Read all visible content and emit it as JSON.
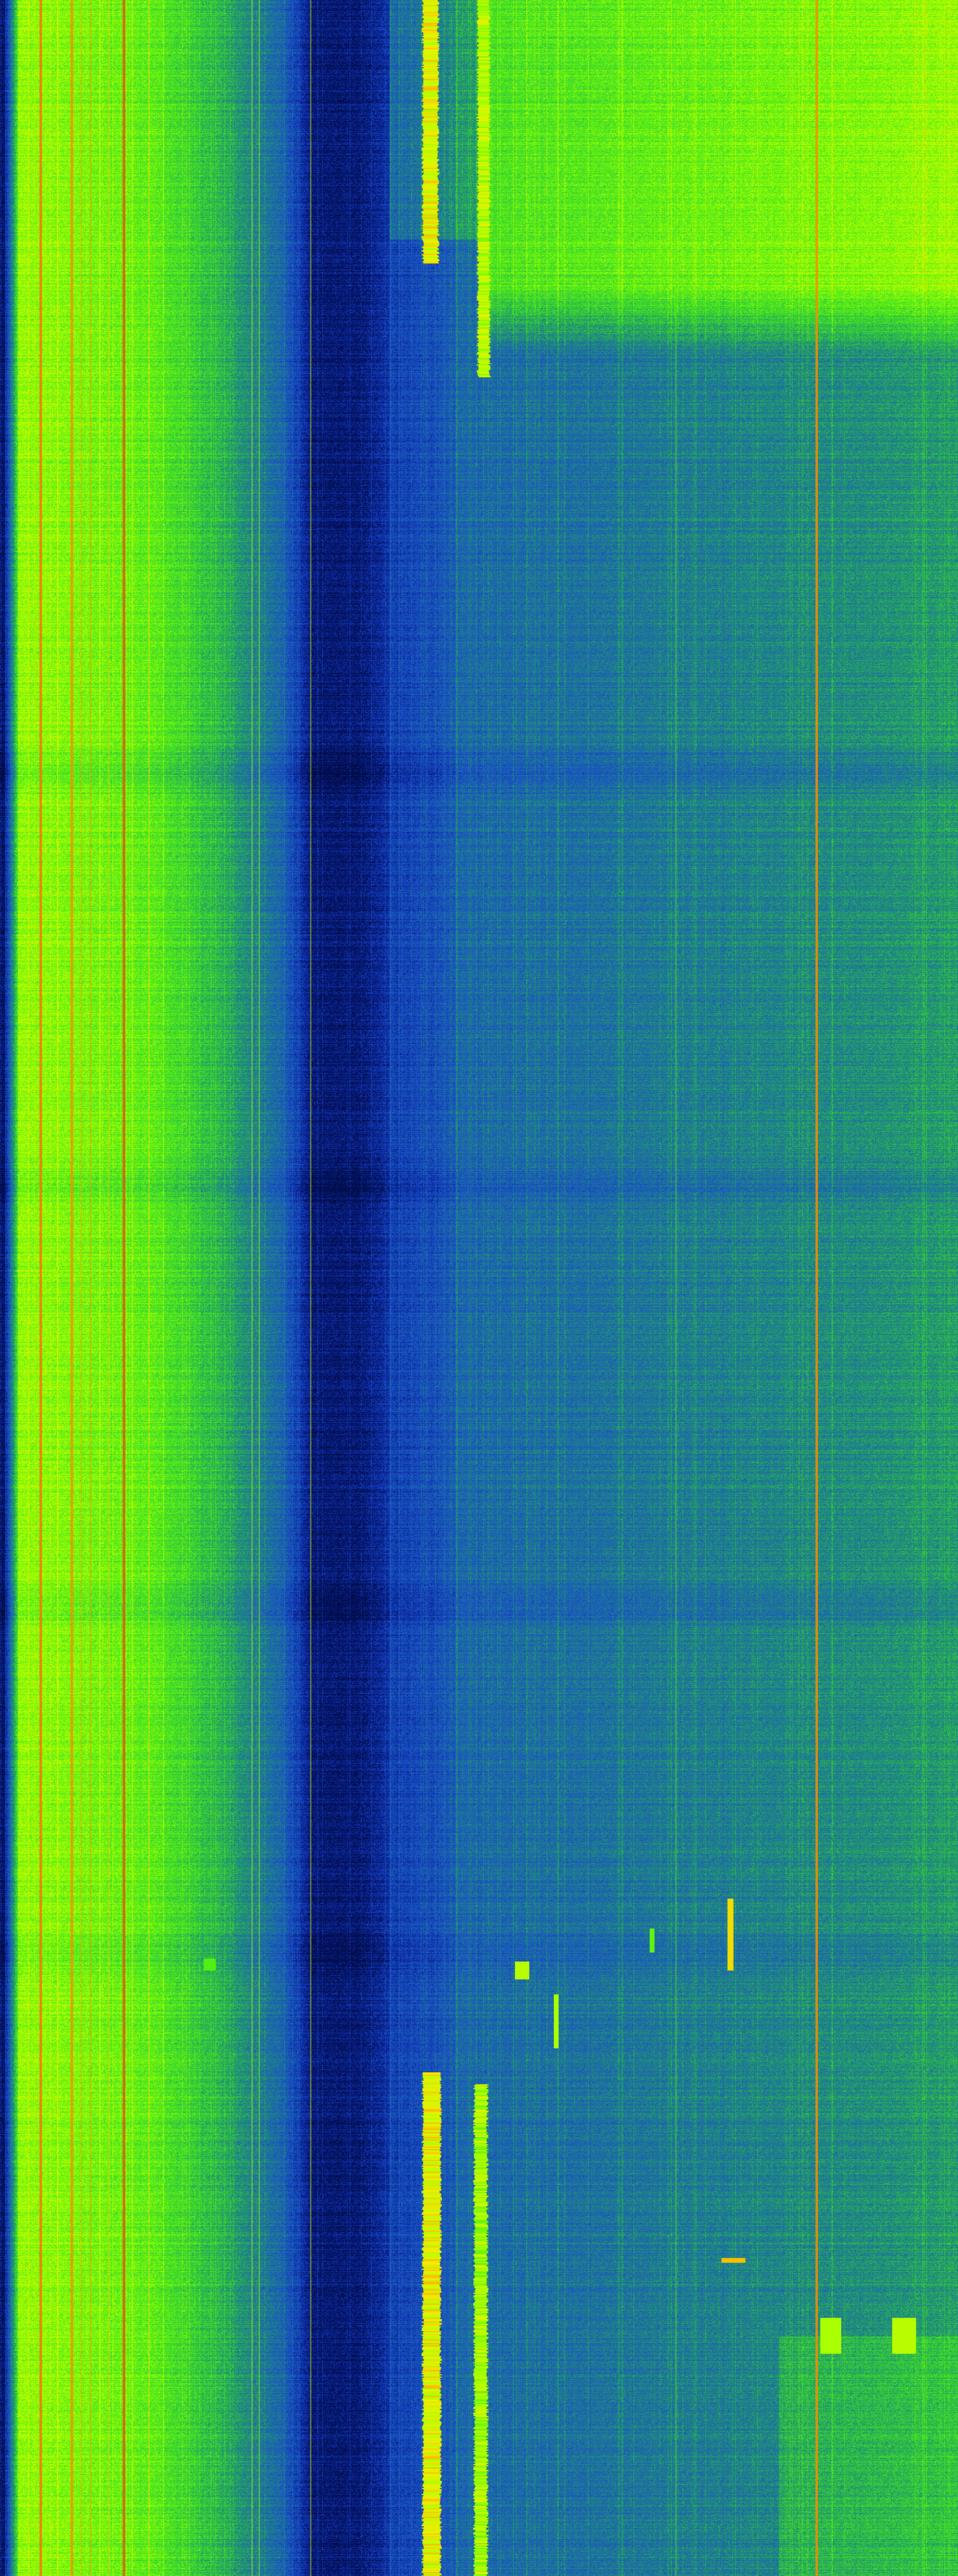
{
  "image": {
    "description": "",
    "colormap": [
      "#000a3c",
      "#0a1e8c",
      "#1446c8",
      "#1e64b4",
      "#1e8c78",
      "#32c83c",
      "#50f014",
      "#aaff00",
      "#f0f000",
      "#ff8c00",
      "#e61414"
    ]
  },
  "features": {
    "persistent_lines": [
      {
        "name": "left-carrier-1",
        "level": 0.92
      },
      {
        "name": "left-carrier-2",
        "level": 0.9
      },
      {
        "name": "left-carrier-3",
        "level": 0.95
      },
      {
        "name": "right-carrier",
        "level": 0.9
      }
    ]
  }
}
